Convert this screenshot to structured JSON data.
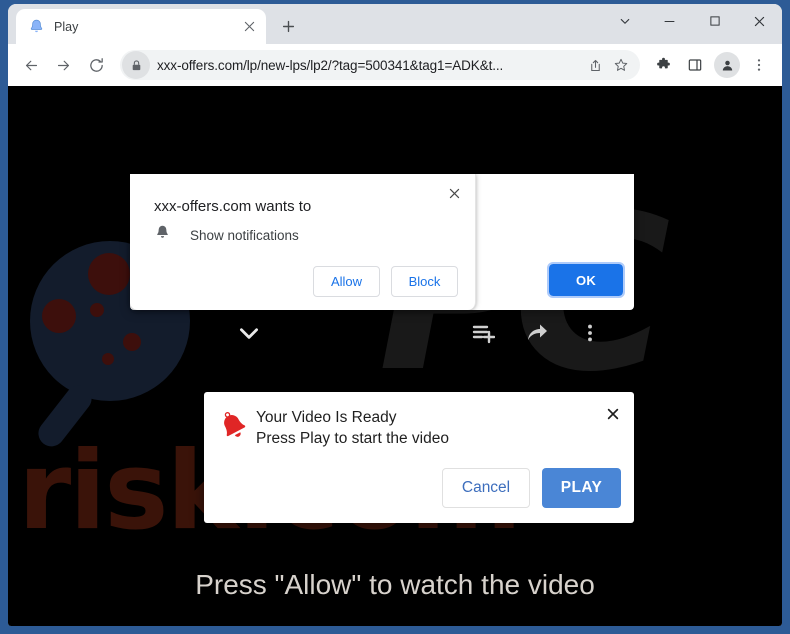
{
  "window": {
    "controls": {
      "tab_search": "tab-search-chevron",
      "minimize": "minimize",
      "maximize": "maximize",
      "close": "close"
    }
  },
  "tabstrip": {
    "tabs": [
      {
        "title": "Play",
        "favicon": "blue-bell-icon",
        "close_label": "×"
      }
    ],
    "new_tab_label": "+"
  },
  "toolbar": {
    "back_label": "back-arrow",
    "forward_label": "forward-arrow",
    "reload_label": "reload-arrow",
    "site_info": "lock-icon",
    "url": "xxx-offers.com/lp/new-lps/lp2/?tag=500341&tag1=ADK&t...",
    "share_label": "share-icon",
    "bookmark_label": "star-icon",
    "extensions_label": "puzzle-icon",
    "side_panel_label": "side-panel-icon",
    "profile_label": "avatar-icon",
    "menu_label": "three-dot-menu"
  },
  "notification_bubble": {
    "title": "xxx-offers.com wants to",
    "permission": "Show notifications",
    "permission_icon": "bell-icon",
    "allow_label": "Allow",
    "block_label": "Block",
    "close_label": "×"
  },
  "js_alert": {
    "ok_label": "OK"
  },
  "video_dialog": {
    "icon": "red-bell-icon",
    "title": "Your Video Is Ready",
    "subtitle": "Press Play to start the video",
    "cancel_label": "Cancel",
    "play_label": "PLAY",
    "close_label": "✕"
  },
  "page": {
    "hero_text": "Press \"Allow\" to watch the video",
    "background_color": "#000000",
    "watermark_text": "risk.com",
    "watermark_letter_p": "P",
    "watermark_letter_c": "C",
    "player_controls": {
      "collapse": "chevron-down-icon",
      "add_to_playlist": "add-to-playlist-icon",
      "share": "share-arrow-icon",
      "more": "more-vertical-icon"
    }
  },
  "colors": {
    "window_frame": "#2d5b96",
    "chrome_blue": "#1a73e8",
    "play_blue": "#4a86d6",
    "bell_red": "#e02626"
  }
}
